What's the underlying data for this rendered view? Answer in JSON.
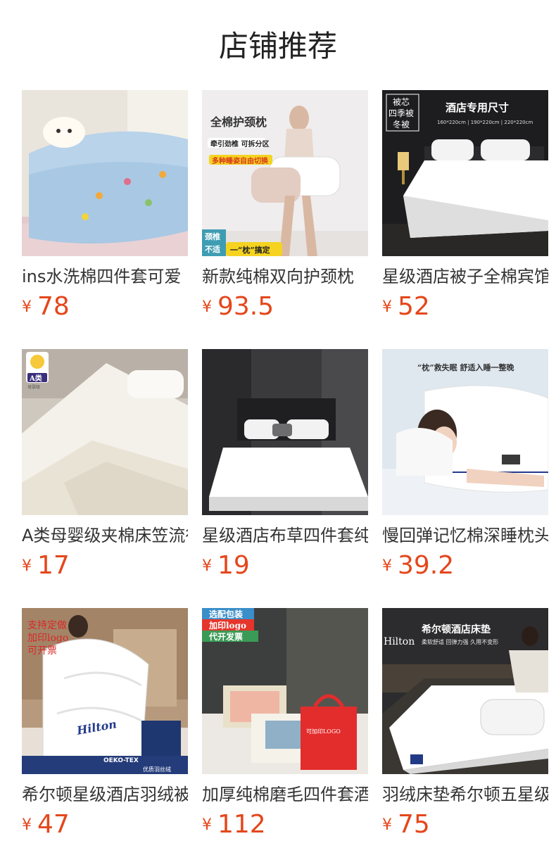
{
  "page_title": "店铺推荐",
  "currency_symbol": "¥",
  "products": [
    {
      "name": "ins水洗棉四件套可爱",
      "price": "78"
    },
    {
      "name": "新款纯棉双向护颈枕",
      "price": "93.5",
      "overlay": {
        "heading": "全棉护颈枕",
        "tag1": "牵引劲椎 可拆分区",
        "tag2": "多种睡姿自由切换",
        "badge_a": "颈椎",
        "badge_b": "不适",
        "badge_c": "一“枕”搞定"
      }
    },
    {
      "name": "星级酒店被子全棉宾馆",
      "price": "52",
      "overlay": {
        "box1": "被芯",
        "box2": "四季被",
        "box3": "冬被",
        "heading": "酒店专用尺寸",
        "sizes": "160*220cm  |  190*220cm  |  220*220cm"
      }
    },
    {
      "name": "A类母婴级夹棉床笠流行",
      "price": "17",
      "overlay": {
        "badge": "A类",
        "badge_sub": "母婴级"
      }
    },
    {
      "name": "星级酒店布草四件套纯棉",
      "price": "19"
    },
    {
      "name": "慢回弹记忆棉深睡枕头",
      "price": "39.2",
      "overlay": {
        "heading": "“枕”救失眠   舒适入睡一整晚"
      }
    },
    {
      "name": "希尔顿星级酒店羽绒被芯",
      "price": "47",
      "overlay": {
        "line1": "支持定做",
        "line2": "加印logo",
        "line3": "可开票",
        "brand": "Hilton",
        "label1": "OEKO-TEX",
        "label2": "优质羽丝绒"
      }
    },
    {
      "name": "加厚纯棉磨毛四件套酒店",
      "price": "112",
      "overlay": {
        "tag1": "选配包装",
        "tag2": "加印logo",
        "tag3": "代开发票",
        "bag": "可加印LOGO"
      }
    },
    {
      "name": "羽绒床垫希尔顿五星级酒",
      "price": "75",
      "overlay": {
        "heading": "希尔顿酒店床垫",
        "brand": "Hilton",
        "sub": "柔软舒适  回弹力强  久用不变形"
      }
    }
  ]
}
